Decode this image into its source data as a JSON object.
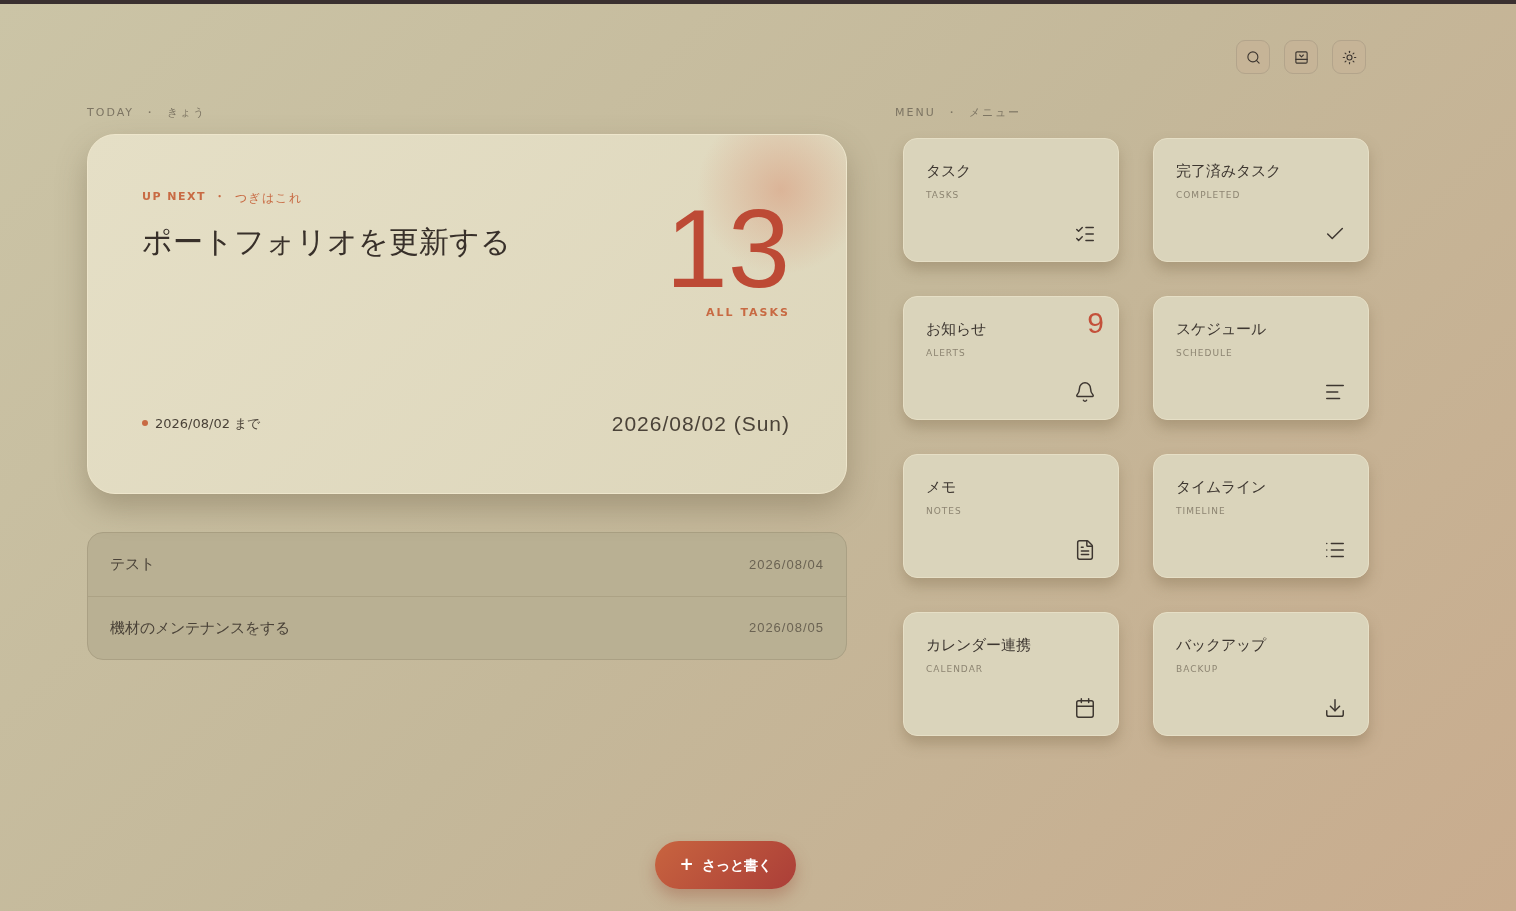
{
  "toolbar": [
    {
      "kind": "search"
    },
    {
      "kind": "layout"
    },
    {
      "kind": "theme"
    }
  ],
  "separator": "・",
  "today": {
    "heading": "TODAY",
    "heading_sub": "きょう",
    "next": {
      "label": "UP NEXT",
      "label_sub": "つぎはこれ",
      "title": "ポートフォリオを更新する",
      "count": "13",
      "count_label": "ALL TASKS",
      "due": "2026/08/02 まで",
      "date": "2026/08/02 (Sun)"
    },
    "tasks": [
      {
        "title": "テスト",
        "date": "2026/08/04"
      },
      {
        "title": "機材のメンテナンスをする",
        "date": "2026/08/05"
      }
    ]
  },
  "menu": {
    "heading": "MENU",
    "heading_sub": "メニュー",
    "items": [
      {
        "title": "タスク",
        "subtitle": "TASKS",
        "kind": "tasks"
      },
      {
        "title": "完了済みタスク",
        "subtitle": "COMPLETED",
        "kind": "completed"
      },
      {
        "title": "お知らせ",
        "subtitle": "ALERTS",
        "kind": "alerts",
        "badge": "9"
      },
      {
        "title": "スケジュール",
        "subtitle": "SCHEDULE",
        "kind": "schedule"
      },
      {
        "title": "メモ",
        "subtitle": "NOTES",
        "kind": "notes"
      },
      {
        "title": "タイムライン",
        "subtitle": "TIMELINE",
        "kind": "timeline"
      },
      {
        "title": "カレンダー連携",
        "subtitle": "CALENDAR",
        "kind": "calendar"
      },
      {
        "title": "バックアップ",
        "subtitle": "BACKUP",
        "kind": "backup"
      }
    ]
  },
  "fab": {
    "icon": "+",
    "label": "さっと書く"
  }
}
